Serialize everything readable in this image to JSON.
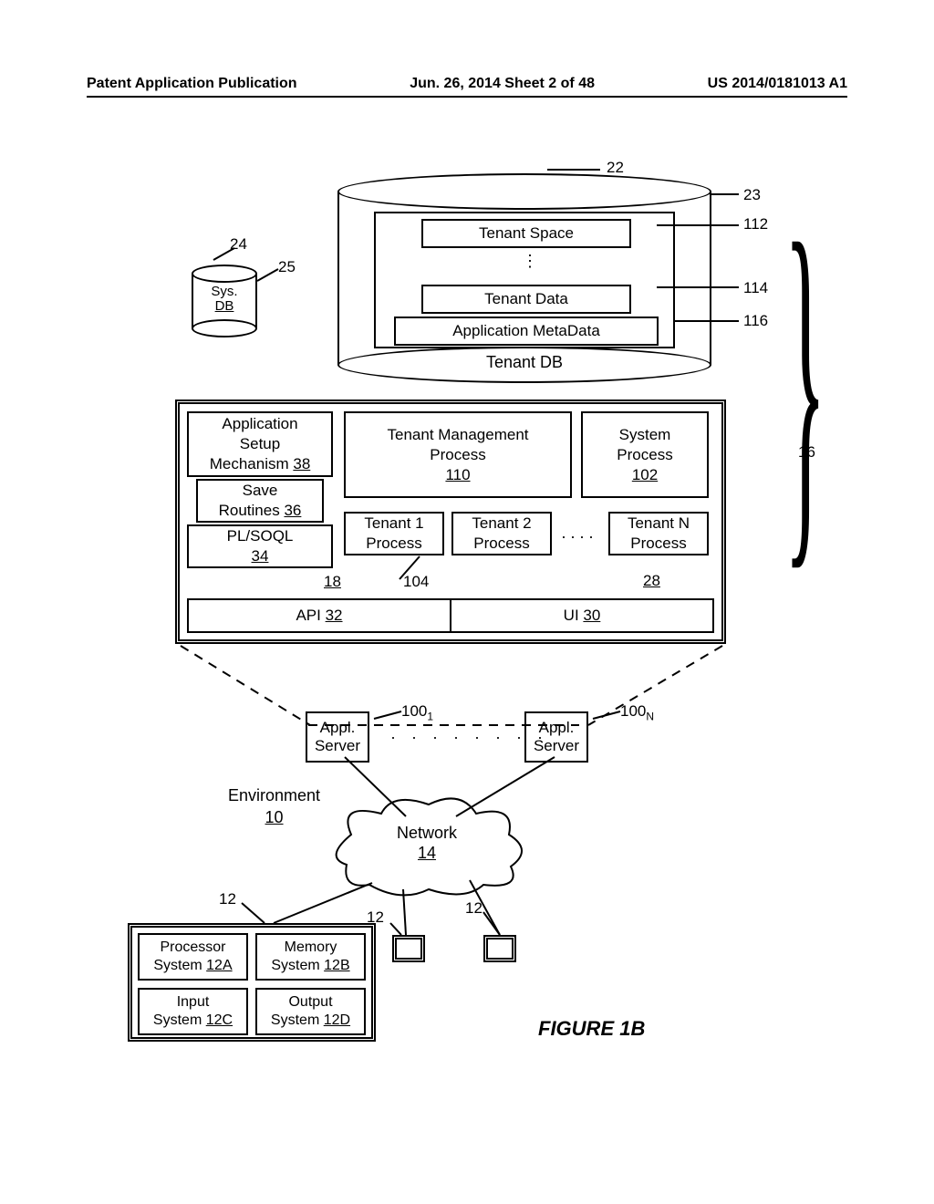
{
  "header": {
    "left": "Patent Application Publication",
    "center": "Jun. 26, 2014  Sheet 2 of 48",
    "right": "US 2014/0181013 A1"
  },
  "sys_db": {
    "line1": "Sys.",
    "line2": "DB"
  },
  "tenant_db": {
    "label": "Tenant DB",
    "tenant_space": "Tenant Space",
    "tenant_data": "Tenant Data",
    "app_meta": "Application MetaData"
  },
  "main": {
    "app_setup": {
      "l1": "Application",
      "l2": "Setup",
      "l3": "Mechanism ",
      "ref": "38"
    },
    "save": {
      "l1": "Save",
      "l2": "Routines ",
      "ref": "36"
    },
    "plsoql": {
      "l1": "PL/SOQL",
      "ref": "34"
    },
    "tmp": {
      "l1": "Tenant Management",
      "l2": "Process",
      "ref": "110"
    },
    "sysproc": {
      "l1": "System",
      "l2": "Process",
      "ref": "102"
    },
    "t1": {
      "l1": "Tenant 1",
      "l2": "Process"
    },
    "t2": {
      "l1": "Tenant 2",
      "l2": "Process"
    },
    "tn": {
      "l1": "Tenant N",
      "l2": "Process"
    },
    "api": "API ",
    "api_ref": "32",
    "ui": "UI ",
    "ui_ref": "30",
    "ref18": "18",
    "ref28": "28"
  },
  "appl": {
    "l1": "Appl.",
    "l2": "Server"
  },
  "env": {
    "l1": "Environment",
    "ref": "10"
  },
  "network": {
    "l1": "Network",
    "ref": "14"
  },
  "client": {
    "proc": {
      "l1": "Processor",
      "l2": "System ",
      "ref": "12A"
    },
    "mem": {
      "l1": "Memory",
      "l2": "System ",
      "ref": "12B"
    },
    "in": {
      "l1": "Input",
      "l2": "System ",
      "ref": "12C"
    },
    "out": {
      "l1": "Output",
      "l2": "System ",
      "ref": "12D"
    }
  },
  "refs": {
    "r22": "22",
    "r23": "23",
    "r24": "24",
    "r25": "25",
    "r112": "112",
    "r114": "114",
    "r116": "116",
    "r16": "16",
    "r1001": "100",
    "r1001s": "1",
    "r100N": "100",
    "r100Ns": "N",
    "r12a": "12",
    "r12b": "12",
    "r12c": "12",
    "r104": "104"
  },
  "figure": "FIGURE 1B"
}
